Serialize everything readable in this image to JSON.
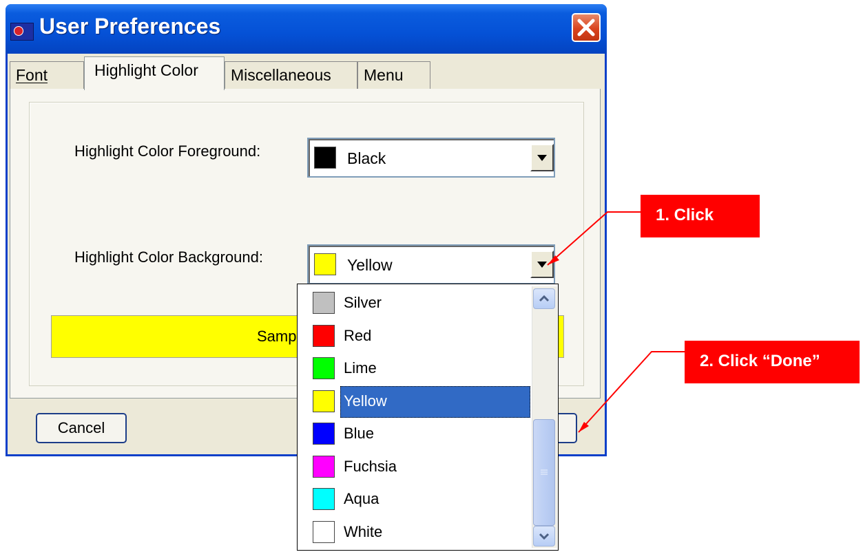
{
  "window": {
    "title": "User Preferences"
  },
  "tabs": [
    {
      "label": "Font",
      "active": false
    },
    {
      "label": "Highlight Color",
      "active": true
    },
    {
      "label": "Miscellaneous",
      "active": false
    },
    {
      "label": "Menu",
      "active": false
    }
  ],
  "foreground": {
    "label": "Highlight Color Foreground:",
    "value": "Black",
    "swatch": "#000000"
  },
  "background": {
    "label": "Highlight Color Background:",
    "value": "Yellow",
    "swatch": "#ffff00"
  },
  "sample": {
    "text": "Samp"
  },
  "buttons": {
    "cancel": "Cancel"
  },
  "dropdown": {
    "items": [
      {
        "label": "Silver",
        "color": "#c0c0c0"
      },
      {
        "label": "Red",
        "color": "#ff0000"
      },
      {
        "label": "Lime",
        "color": "#00ff00"
      },
      {
        "label": "Yellow",
        "color": "#ffff00",
        "selected": true
      },
      {
        "label": "Blue",
        "color": "#0000ff"
      },
      {
        "label": "Fuchsia",
        "color": "#ff00ff"
      },
      {
        "label": "Aqua",
        "color": "#00ffff"
      },
      {
        "label": "White",
        "color": "#ffffff"
      }
    ]
  },
  "callouts": {
    "step1": "1. Click",
    "step2": "2. Click “Done”"
  },
  "colors": {
    "titlebar": "#0551d6",
    "callout": "#ff0000",
    "selection": "#316ac5"
  }
}
